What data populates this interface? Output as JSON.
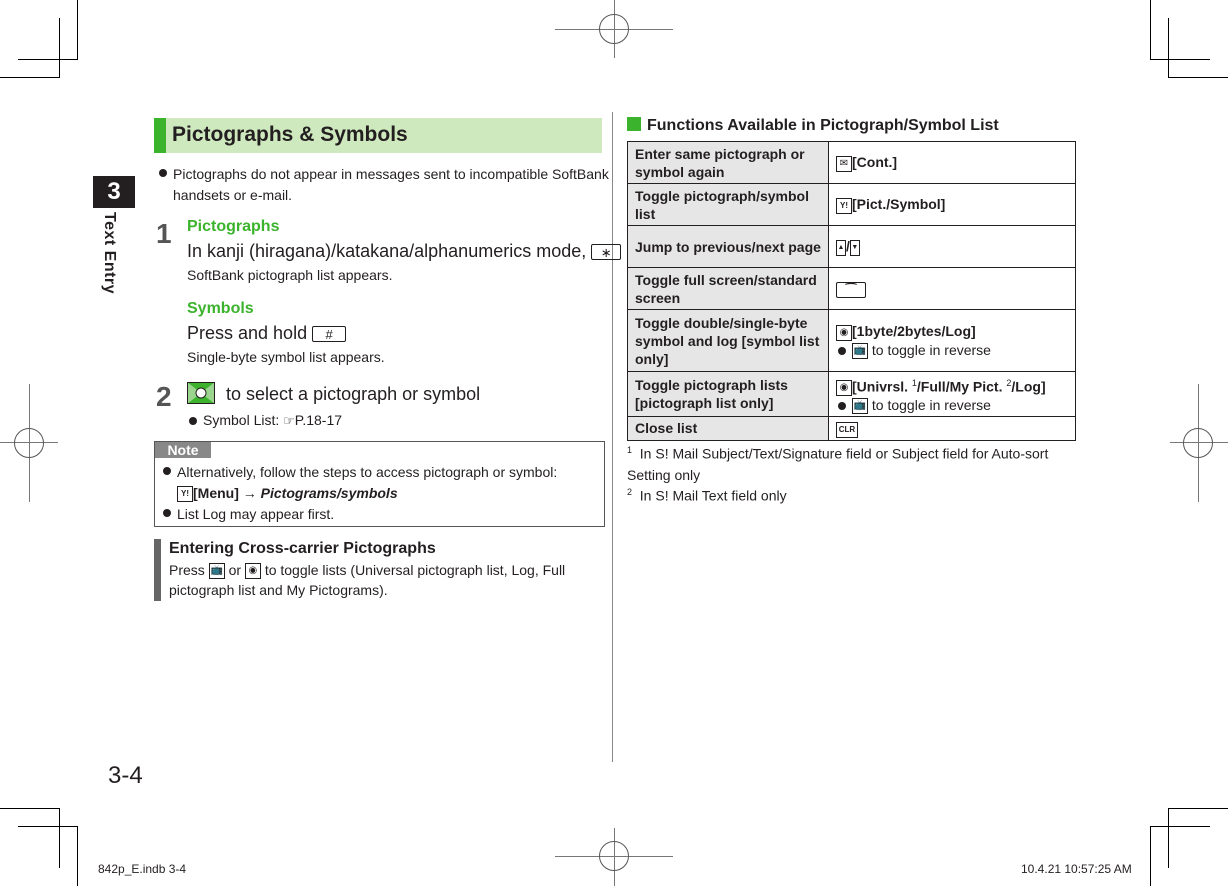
{
  "chapter": {
    "number": "3",
    "title": "Text Entry"
  },
  "page_number": "3-4",
  "section": {
    "title": "Pictographs & Symbols",
    "intro_bullet": "Pictographs do not appear in messages sent to incompatible SoftBank handsets or e-mail.",
    "steps": [
      {
        "number": "1",
        "sub": [
          {
            "heading": "Pictographs",
            "instruction": "In kanji (hiragana)/katakana/alphanumerics mode,",
            "key": "∗",
            "result": "SoftBank pictograph list appears."
          },
          {
            "heading": "Symbols",
            "instruction": "Press and hold",
            "key": "#",
            "result": "Single-byte symbol list appears."
          }
        ]
      },
      {
        "number": "2",
        "instruction": "to select a pictograph or symbol",
        "bullet_label": "Symbol List:",
        "bullet_ref": "P.18-17"
      }
    ],
    "note": {
      "label": "Note",
      "items": [
        {
          "text": "Alternatively, follow the steps to access pictograph or symbol:",
          "path_key": "[Menu]",
          "arrow": "→",
          "path_item": "Pictograms/symbols"
        },
        {
          "text": "List Log may appear first."
        }
      ]
    },
    "cross_carrier": {
      "heading": "Entering Cross-carrier Pictographs",
      "press": "Press",
      "or": "or",
      "body": "to toggle lists (Universal pictograph list, Log, Full pictograph list and My Pictograms)."
    }
  },
  "functions": {
    "title": "Functions Available in Pictograph/Symbol List",
    "rows": [
      {
        "function": "Enter same pictograph or symbol again",
        "key_icon": "mail-key",
        "operation": "[Cont.]"
      },
      {
        "function": "Toggle pictograph/symbol list",
        "key_icon": "yahoo-key",
        "operation": "[Pict./Symbol]"
      },
      {
        "function": "Jump to previous/next page",
        "key_icon": "up-down-keys",
        "operation": "/"
      },
      {
        "function": "Toggle full screen/standard screen",
        "key_icon": "call-key",
        "operation": ""
      },
      {
        "function": "Toggle double/single-byte symbol and log [symbol list only]",
        "key_icon": "camera-key",
        "operation": "[1byte/2bytes/Log]",
        "sub_bullet": "to toggle in reverse"
      },
      {
        "function": "Toggle pictograph lists [pictograph list only]",
        "key_icon": "camera-key",
        "operation_parts": [
          "[Univrsl. ",
          "1",
          "/Full/My Pict. ",
          "2",
          "/Log]"
        ],
        "sub_bullet": "to toggle in reverse"
      },
      {
        "function": "Close list",
        "key_icon": "clear-key",
        "key_label": "CLR",
        "operation": ""
      }
    ],
    "footnotes": [
      {
        "mark": "1",
        "text": "In S! Mail Subject/Text/Signature field or Subject field for Auto-sort Setting only"
      },
      {
        "mark": "2",
        "text": "In S! Mail Text field only"
      }
    ]
  },
  "slug": {
    "file": "842p_E.indb   3-4",
    "timestamp": "10.4.21   10:57:25 AM"
  },
  "colors": {
    "accent_green": "#3cb32d",
    "header_bg": "#cfe9bf",
    "table_label_bg": "#e6e6e6"
  }
}
